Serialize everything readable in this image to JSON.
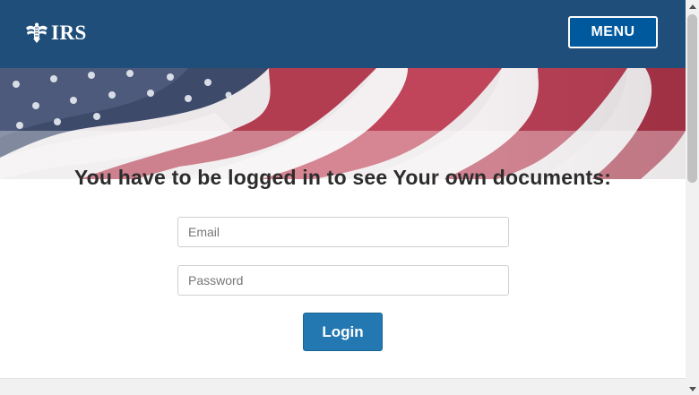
{
  "header": {
    "logo_text": "IRS",
    "menu_label": "MENU",
    "background_color": "#1f4e7a",
    "menu_button_color": "#00599c"
  },
  "hero": {
    "image": "american-flag-banner"
  },
  "main": {
    "title": "You have to be logged in to see Your own documents:",
    "email_placeholder": "Email",
    "password_placeholder": "Password",
    "login_label": "Login",
    "login_button_color": "#2478b2"
  },
  "icons": {
    "logo": "irs-eagle-icon",
    "scroll_up": "scroll-up-arrow-icon",
    "scroll_down": "scroll-down-arrow-icon"
  }
}
